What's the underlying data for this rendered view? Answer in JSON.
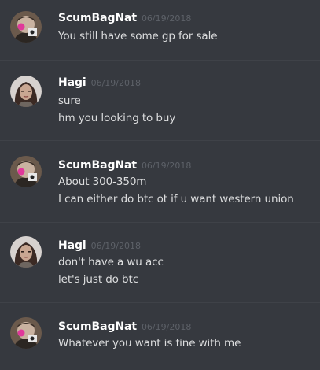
{
  "channel": {
    "messages": [
      {
        "author": "ScumBagNat",
        "timestamp": "06/19/2018",
        "avatar_icon": "avatar-scumbagnat-icon",
        "lines": [
          "You still have some gp for sale"
        ]
      },
      {
        "author": "Hagi",
        "timestamp": "06/19/2018",
        "avatar_icon": "avatar-hagi-icon",
        "lines": [
          "sure",
          "hm you looking to buy"
        ]
      },
      {
        "author": "ScumBagNat",
        "timestamp": "06/19/2018",
        "avatar_icon": "avatar-scumbagnat-icon",
        "lines": [
          "About 300-350m",
          "I can either do btc ot if u want western union"
        ]
      },
      {
        "author": "Hagi",
        "timestamp": "06/19/2018",
        "avatar_icon": "avatar-hagi-icon",
        "lines": [
          "don't have a wu acc",
          "let's just do btc"
        ]
      },
      {
        "author": "ScumBagNat",
        "timestamp": "06/19/2018",
        "avatar_icon": "avatar-scumbagnat-icon",
        "lines": [
          "Whatever you want is fine with me"
        ]
      }
    ]
  },
  "colors": {
    "background": "#36393f",
    "username": "#ffffff",
    "timestamp": "#5d6168",
    "message_text": "#dcddde",
    "divider": "#3f4248"
  }
}
